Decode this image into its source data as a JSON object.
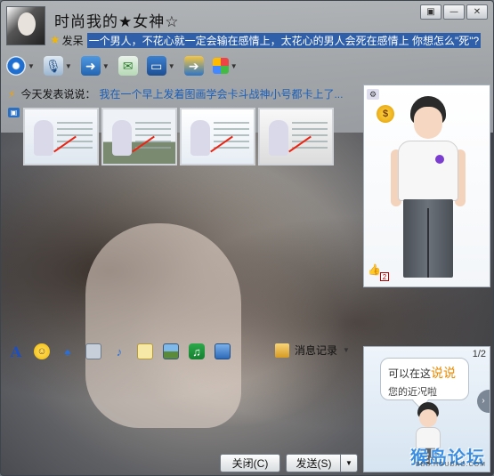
{
  "title_bar": {
    "nickname": "时尚我的★女神☆",
    "status_text": "发呆",
    "signature": "一个男人，不花心就一定会输在感情上，太花心的男人会死在感情上 你想怎么\"死\"?",
    "menu_icon": "dropdown-menu-icon",
    "minimize": "—",
    "close": "✕"
  },
  "today_status": {
    "label": "今天发表说说：",
    "text": "我在一个早上发着图画学会卡斗战神小号都卡上了..."
  },
  "input_toolbar": {
    "history_label": "消息记录"
  },
  "buttons": {
    "close_label": "关闭(C)",
    "send_label": "发送(S)"
  },
  "ad": {
    "page": "1/2",
    "bubble_line1_prefix": "可以在这",
    "bubble_highlight": "说说",
    "bubble_line2": "您的近况啦",
    "watermark": "猴岛论坛",
    "watermark_sub": "BBS.HOUDAO.COM"
  },
  "colors": {
    "signature_bg": "#2f5fa8",
    "link": "#1c5fb8",
    "accent": "#e68a00"
  }
}
